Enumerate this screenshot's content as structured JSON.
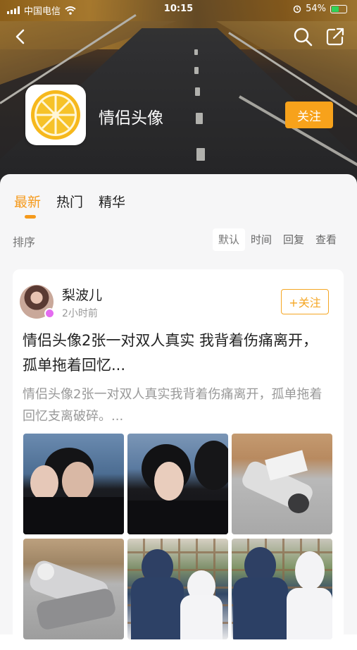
{
  "status_bar": {
    "carrier": "中国电信",
    "time": "10:15",
    "battery": "54%"
  },
  "group": {
    "name": "情侣头像",
    "follow_label": "关注"
  },
  "tabs": [
    {
      "label": "最新",
      "active": true
    },
    {
      "label": "热门",
      "active": false
    },
    {
      "label": "精华",
      "active": false
    }
  ],
  "sort": {
    "label": "排序",
    "options": [
      "默认",
      "时间",
      "回复",
      "查看"
    ],
    "selected": "默认"
  },
  "post": {
    "author": "梨波儿",
    "time": "2小时前",
    "follow_label": "+关注",
    "title": "情侣头像2张一对双人真实 我背着伤痛离开，孤单拖着回忆...",
    "excerpt": "情侣头像2张一对双人真实我背着伤痛离开，孤单拖着回忆支离破碎。...",
    "image_count": 6
  },
  "colors": {
    "accent": "#f59a1c",
    "follow_bg": "#f7a21b"
  }
}
